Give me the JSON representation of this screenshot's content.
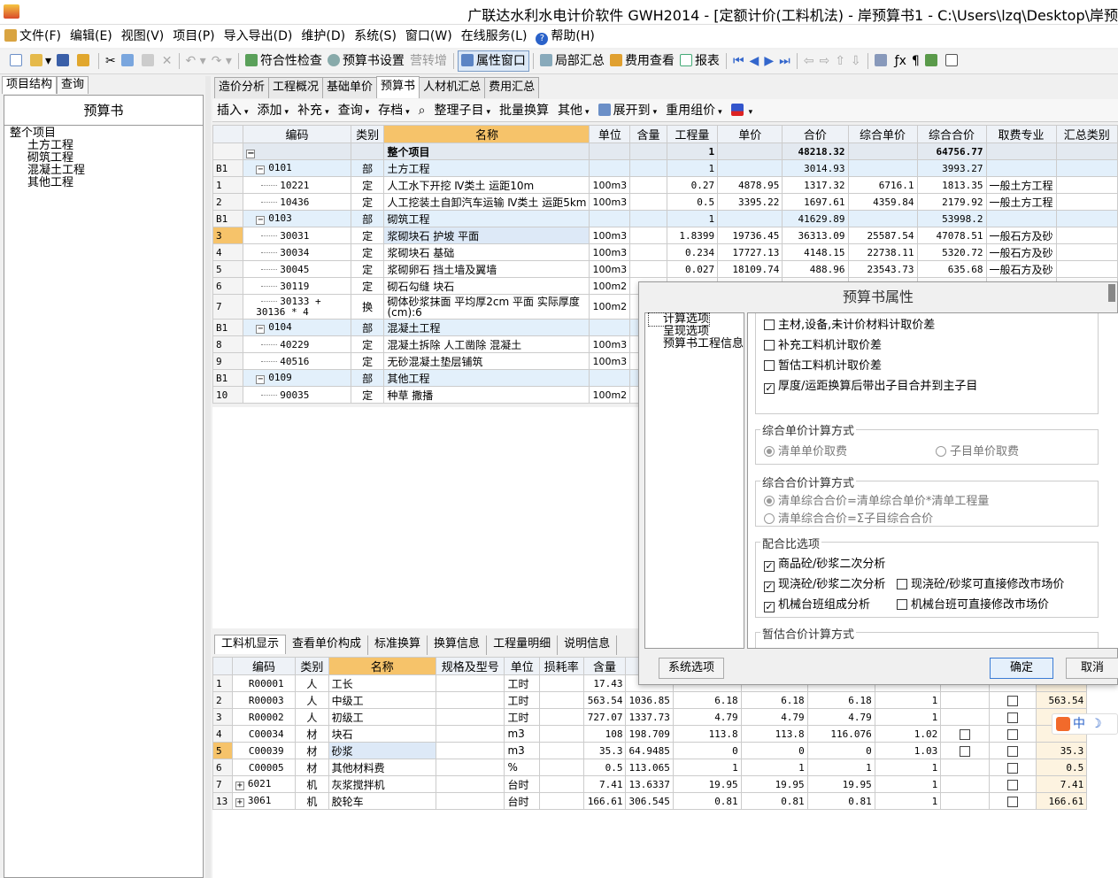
{
  "window": {
    "title": "广联达水利水电计价软件 GWH2014 - [定额计价(工料机法) - 岸预算书1 - C:\\Users\\lzq\\Desktop\\岸预"
  },
  "menu": [
    "文件(F)",
    "编辑(E)",
    "视图(V)",
    "项目(P)",
    "导入导出(D)",
    "维护(D)",
    "系统(S)",
    "窗口(W)",
    "在线服务(L)",
    "帮助(H)"
  ],
  "toolbar1": {
    "check": "符合性检查",
    "budget_settings": "预算书设置",
    "vat": "营转增",
    "property_window": "属性窗口",
    "partial_summary": "局部汇总",
    "fee_view": "费用查看",
    "report": "报表"
  },
  "left": {
    "tabs": [
      "项目结构",
      "查询"
    ],
    "header": "预算书",
    "tree": [
      "整个项目",
      "土方工程",
      "砌筑工程",
      "混凝土工程",
      "其他工程"
    ]
  },
  "main_tabs": [
    "造价分析",
    "工程概况",
    "基础单价",
    "预算书",
    "人材机汇总",
    "费用汇总"
  ],
  "toolbar2": [
    "插入",
    "添加",
    "补充",
    "查询",
    "存档",
    "整理子目",
    "批量换算",
    "其他",
    "展开到",
    "重用组价"
  ],
  "grid1": {
    "headers": [
      "编码",
      "类别",
      "名称",
      "单位",
      "含量",
      "工程量",
      "单价",
      "合价",
      "综合单价",
      "综合合价",
      "取费专业",
      "汇总类别"
    ],
    "summary": {
      "name": "整个项目",
      "qty": "1",
      "total": "48218.32",
      "comp_total": "64756.77"
    },
    "rows": [
      {
        "rn": "B1",
        "code": "0101",
        "type": "部",
        "name": "土方工程",
        "unit": "",
        "qty": "1",
        "price": "",
        "total": "3014.93",
        "cprice": "",
        "ctotal": "3993.27",
        "fee": "",
        "part": true
      },
      {
        "rn": "1",
        "code": "10221",
        "type": "定",
        "name": "人工水下开挖 Ⅳ类土 运距10m",
        "unit": "100m3",
        "qty": "0.27",
        "price": "4878.95",
        "total": "1317.32",
        "cprice": "6716.1",
        "ctotal": "1813.35",
        "fee": "一般土方工程"
      },
      {
        "rn": "2",
        "code": "10436",
        "type": "定",
        "name": "人工挖装土自卸汽车运输 Ⅳ类土 运距5km",
        "unit": "100m3",
        "qty": "0.5",
        "price": "3395.22",
        "total": "1697.61",
        "cprice": "4359.84",
        "ctotal": "2179.92",
        "fee": "一般土方工程"
      },
      {
        "rn": "B1",
        "code": "0103",
        "type": "部",
        "name": "砌筑工程",
        "unit": "",
        "qty": "1",
        "price": "",
        "total": "41629.89",
        "cprice": "",
        "ctotal": "53998.2",
        "fee": "",
        "part": true
      },
      {
        "rn": "3",
        "code": "30031",
        "type": "定",
        "name": "浆砌块石 护坡 平面",
        "unit": "100m3",
        "qty": "1.8399",
        "price": "19736.45",
        "total": "36313.09",
        "cprice": "25587.54",
        "ctotal": "47078.51",
        "fee": "一般石方及砂",
        "hl": true
      },
      {
        "rn": "4",
        "code": "30034",
        "type": "定",
        "name": "浆砌块石 基础",
        "unit": "100m3",
        "qty": "0.234",
        "price": "17727.13",
        "total": "4148.15",
        "cprice": "22738.11",
        "ctotal": "5320.72",
        "fee": "一般石方及砂"
      },
      {
        "rn": "5",
        "code": "30045",
        "type": "定",
        "name": "浆砌卵石 挡土墙及翼墙",
        "unit": "100m3",
        "qty": "0.027",
        "price": "18109.74",
        "total": "488.96",
        "cprice": "23543.73",
        "ctotal": "635.68",
        "fee": "一般石方及砂"
      },
      {
        "rn": "6",
        "code": "30119",
        "type": "定",
        "name": "砌石勾缝 块石",
        "unit": "100m2",
        "qty": "",
        "price": "",
        "total": "",
        "cprice": "",
        "ctotal": "",
        "fee": ""
      },
      {
        "rn": "7",
        "code": "30133 + 30136 * 4",
        "type": "换",
        "name": "砌体砂浆抹面 平均厚2cm 平面  实际厚度(cm):6",
        "unit": "100m2",
        "qty": "",
        "price": "",
        "total": "",
        "cprice": "",
        "ctotal": "",
        "fee": "",
        "tall": true
      },
      {
        "rn": "B1",
        "code": "0104",
        "type": "部",
        "name": "混凝土工程",
        "unit": "",
        "qty": "",
        "price": "",
        "total": "",
        "cprice": "",
        "ctotal": "",
        "fee": "",
        "part": true
      },
      {
        "rn": "8",
        "code": "40229",
        "type": "定",
        "name": "混凝土拆除 人工凿除 混凝土",
        "unit": "100m3",
        "qty": "",
        "price": "",
        "total": "",
        "cprice": "",
        "ctotal": "",
        "fee": ""
      },
      {
        "rn": "9",
        "code": "40516",
        "type": "定",
        "name": "无砂混凝土垫层铺筑",
        "unit": "100m3",
        "qty": "",
        "price": "",
        "total": "",
        "cprice": "",
        "ctotal": "",
        "fee": ""
      },
      {
        "rn": "B1",
        "code": "0109",
        "type": "部",
        "name": "其他工程",
        "unit": "",
        "qty": "",
        "price": "",
        "total": "",
        "cprice": "",
        "ctotal": "",
        "fee": "",
        "part": true
      },
      {
        "rn": "10",
        "code": "90035",
        "type": "定",
        "name": "种草 撒播",
        "unit": "100m2",
        "qty": "",
        "price": "",
        "total": "",
        "cprice": "",
        "ctotal": "",
        "fee": ""
      }
    ]
  },
  "bottom_tabs": [
    "工料机显示",
    "查看单价构成",
    "标准换算",
    "换算信息",
    "工程量明细",
    "说明信息"
  ],
  "grid2": {
    "headers": [
      "编码",
      "类别",
      "名称",
      "规格及型号",
      "单位",
      "损耗率",
      "含量"
    ],
    "rows": [
      {
        "rn": "1",
        "code": "R00001",
        "type": "人",
        "name": "工长",
        "unit": "工时",
        "c1": "17.43",
        "c2": "",
        "c3": "",
        "c4": "",
        "c5": "",
        "c6": "",
        "ck1": false,
        "ck2": false,
        "last": ""
      },
      {
        "rn": "2",
        "code": "R00003",
        "type": "人",
        "name": "中级工",
        "unit": "工时",
        "c1": "563.54",
        "c2": "1036.85",
        "c3": "6.18",
        "c4": "6.18",
        "c5": "6.18",
        "c6": "1",
        "ck1": false,
        "ck2": true,
        "last": "563.54"
      },
      {
        "rn": "3",
        "code": "R00002",
        "type": "人",
        "name": "初级工",
        "unit": "工时",
        "c1": "727.07",
        "c2": "1337.73",
        "c3": "4.79",
        "c4": "4.79",
        "c5": "4.79",
        "c6": "1",
        "ck1": false,
        "ck2": true,
        "last": ""
      },
      {
        "rn": "4",
        "code": "C00034",
        "type": "材",
        "name": "块石",
        "unit": "m3",
        "c1": "108",
        "c2": "198.709",
        "c3": "113.8",
        "c4": "113.8",
        "c5": "116.076",
        "c6": "1.02",
        "ck1": true,
        "ck2": true,
        "last": ""
      },
      {
        "rn": "5",
        "code": "C00039",
        "type": "材",
        "name": "砂浆",
        "unit": "m3",
        "c1": "35.3",
        "c2": "64.9485",
        "c3": "0",
        "c4": "0",
        "c5": "0",
        "c6": "1.03",
        "ck1": true,
        "ck2": true,
        "last": "35.3",
        "hl": true
      },
      {
        "rn": "6",
        "code": "C00005",
        "type": "材",
        "name": "其他材料费",
        "unit": "%",
        "c1": "0.5",
        "c2": "113.065",
        "c3": "1",
        "c4": "1",
        "c5": "1",
        "c6": "1",
        "ck1": false,
        "ck2": true,
        "last": "0.5"
      },
      {
        "rn": "7",
        "code": "6021",
        "type": "机",
        "name": "灰浆搅拌机",
        "unit": "台时",
        "c1": "7.41",
        "c2": "13.6337",
        "c3": "19.95",
        "c4": "19.95",
        "c5": "19.95",
        "c6": "1",
        "ck1": false,
        "ck2": true,
        "last": "7.41",
        "exp": true
      },
      {
        "rn": "13",
        "code": "3061",
        "type": "机",
        "name": "胶轮车",
        "unit": "台时",
        "c1": "166.61",
        "c2": "306.545",
        "c3": "0.81",
        "c4": "0.81",
        "c5": "0.81",
        "c6": "1",
        "ck1": false,
        "ck2": true,
        "last": "166.61",
        "exp": true
      }
    ]
  },
  "dialog": {
    "title": "预算书属性",
    "nav": [
      "计算选项",
      "呈现选项",
      "预算书工程信息"
    ],
    "top_checks": [
      {
        "label": "主材,设备,未计价材料计取价差",
        "checked": false
      },
      {
        "label": "补充工料机计取价差",
        "checked": false
      },
      {
        "label": "暂估工料机计取价差",
        "checked": false
      },
      {
        "label": "厚度/运距换算后带出子目合并到主子目",
        "checked": true
      }
    ],
    "unit_price_method": {
      "legend": "综合单价计算方式",
      "opt1": "清单单价取费",
      "opt2": "子目单价取费"
    },
    "total_price_method": {
      "legend": "综合合价计算方式",
      "opt1": "清单综合合价=清单综合单价*清单工程量",
      "opt2": "清单综合合价=Σ子目综合合价"
    },
    "mix": {
      "legend": "配合比选项",
      "c1": "商品砼/砂浆二次分析",
      "c2": "现浇砼/砂浆二次分析",
      "c3": "现浇砼/砂浆可直接修改市场价",
      "c4": "机械台班组成分析",
      "c5": "机械台班可直接修改市场价"
    },
    "estimate_legend": "暂估合价计算方式",
    "buttons": {
      "system": "系统选项",
      "ok": "确定",
      "cancel": "取消"
    }
  },
  "ime": {
    "label": "中"
  }
}
